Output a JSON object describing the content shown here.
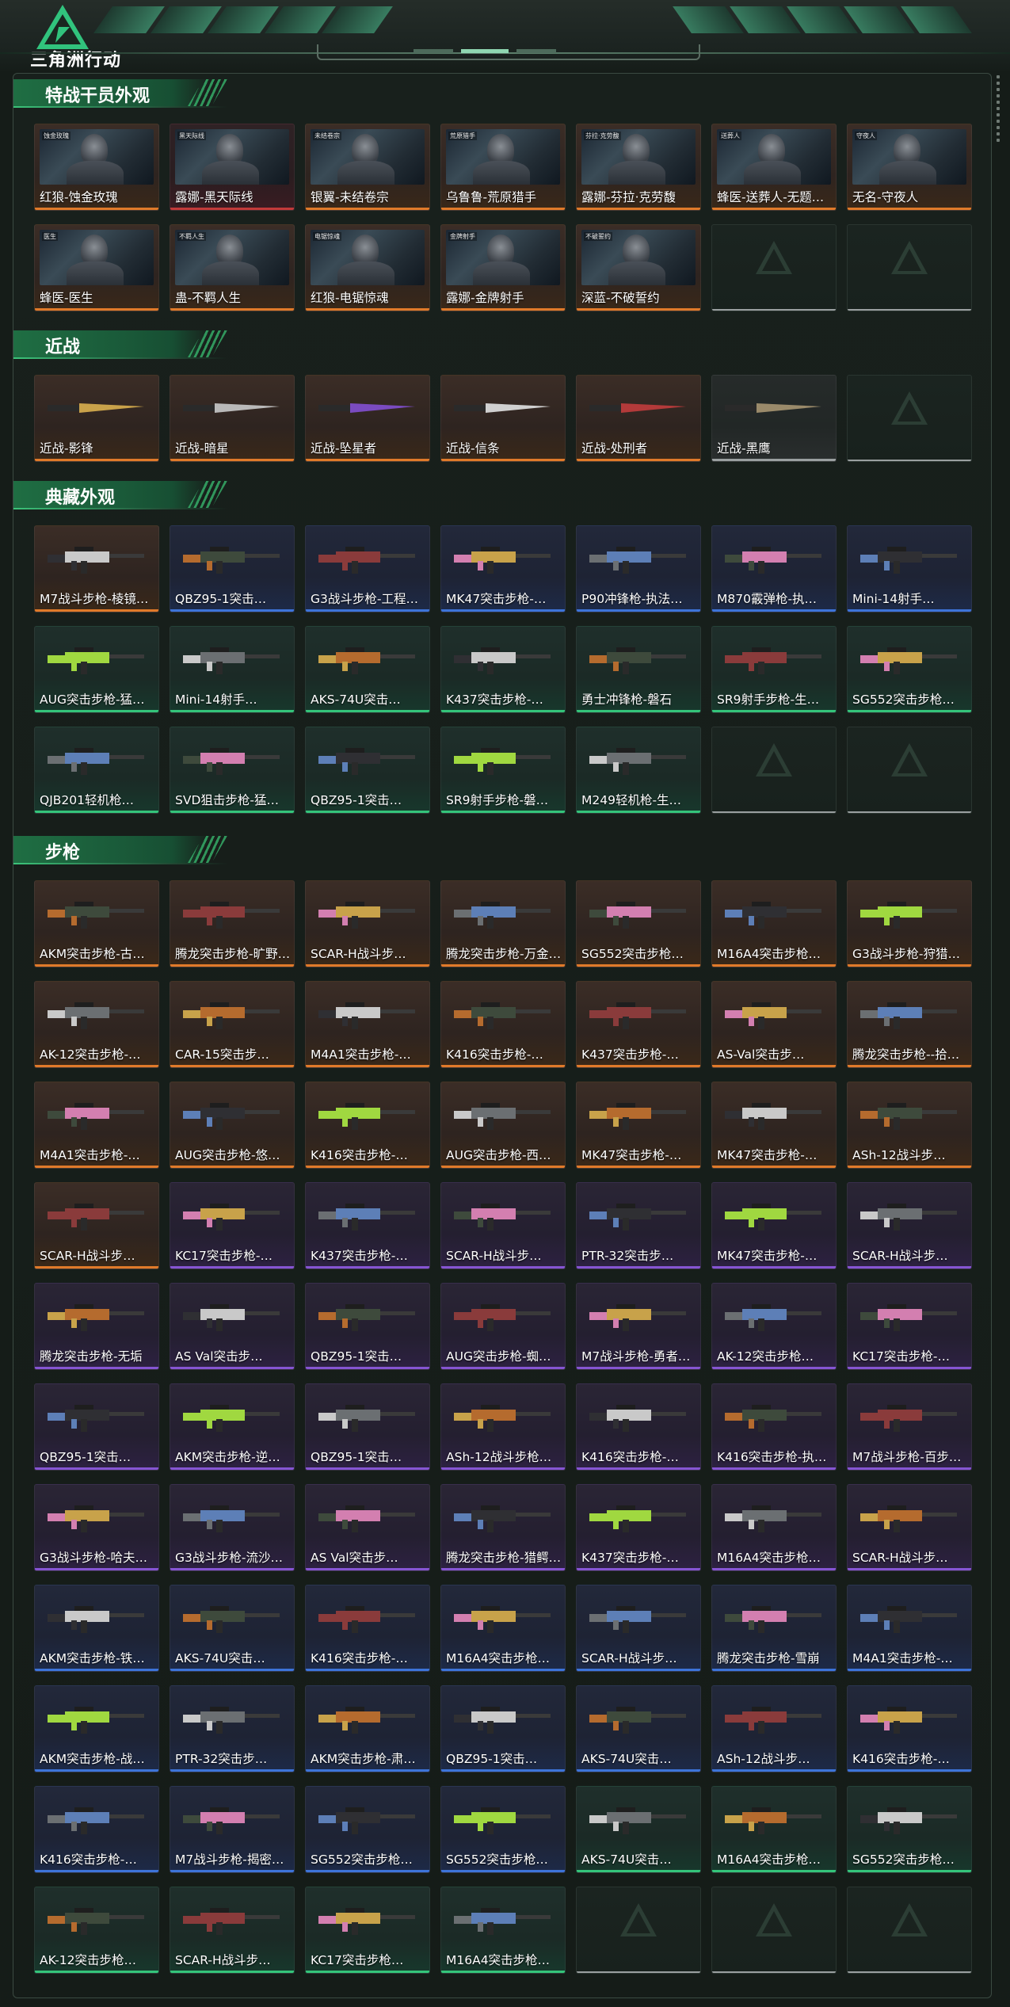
{
  "header": {
    "logo_text": "三角洲行动",
    "logo_icon": "delta-triangle-logo-icon"
  },
  "colors": {
    "background": "#151c18",
    "section_green": "#1f6e43",
    "quality_orange": "#e07a2a",
    "quality_blue": "#3d74d9",
    "quality_green": "#34c47a",
    "quality_purple": "#8655d3",
    "quality_red": "#c23a3a",
    "quality_gray": "#9a9fa0"
  },
  "sections": [
    {
      "title": "特战干员外观",
      "kind": "portrait",
      "items": [
        {
          "label": "红狼-蚀金玫瑰",
          "q": "orange",
          "tag": "蚀金玫瑰"
        },
        {
          "label": "露娜-黑天际线",
          "q": "red",
          "tag": "黑天际线"
        },
        {
          "label": "银翼-未结卷宗",
          "q": "orange",
          "tag": "未结卷宗"
        },
        {
          "label": "乌鲁鲁-荒原猎手",
          "q": "orange",
          "tag": "荒原猎手"
        },
        {
          "label": "露娜-芬拉·克劳馥",
          "q": "orange",
          "tag": "芬拉·克劳馥"
        },
        {
          "label": "蜂医-送葬人-无题…",
          "q": "orange",
          "tag": "送葬人"
        },
        {
          "label": "无名-守夜人",
          "q": "orange",
          "tag": "守夜人"
        },
        {
          "label": "蜂医-医生",
          "q": "orange",
          "tag": "医生"
        },
        {
          "label": "蛊-不羁人生",
          "q": "orange",
          "tag": "不羁人生"
        },
        {
          "label": "红狼-电锯惊魂",
          "q": "orange",
          "tag": "电锯惊魂"
        },
        {
          "label": "露娜-金牌射手",
          "q": "orange",
          "tag": "金牌射手"
        },
        {
          "label": "深蓝-不破誓约",
          "q": "orange",
          "tag": "不破誓约"
        },
        {
          "label": "",
          "q": "empty"
        },
        {
          "label": "",
          "q": "empty"
        }
      ]
    },
    {
      "title": "近战",
      "kind": "knife",
      "items": [
        {
          "label": "近战-影锋",
          "q": "orange"
        },
        {
          "label": "近战-暗星",
          "q": "orange"
        },
        {
          "label": "近战-坠星者",
          "q": "orange"
        },
        {
          "label": "近战-信条",
          "q": "orange"
        },
        {
          "label": "近战-处刑者",
          "q": "orange"
        },
        {
          "label": "近战-黑鹰",
          "q": "gray"
        },
        {
          "label": "",
          "q": "empty"
        }
      ]
    },
    {
      "title": "典藏外观",
      "kind": "gun",
      "items": [
        {
          "label": "M7战斗步枪-棱镜…",
          "q": "orange"
        },
        {
          "label": "QBZ95-1突击…",
          "q": "blue"
        },
        {
          "label": "G3战斗步枪-工程…",
          "q": "blue"
        },
        {
          "label": "MK47突击步枪-…",
          "q": "blue"
        },
        {
          "label": "P90冲锋枪-执法…",
          "q": "blue"
        },
        {
          "label": "M870霰弹枪-执…",
          "q": "blue"
        },
        {
          "label": "Mini-14射手…",
          "q": "blue"
        },
        {
          "label": "AUG突击步枪-猛…",
          "q": "green"
        },
        {
          "label": "Mini-14射手…",
          "q": "green"
        },
        {
          "label": "AKS-74U突击…",
          "q": "green"
        },
        {
          "label": "K437突击步枪-…",
          "q": "green"
        },
        {
          "label": "勇士冲锋枪-磐石",
          "q": "green"
        },
        {
          "label": "SR9射手步枪-生…",
          "q": "green"
        },
        {
          "label": "SG552突击步枪…",
          "q": "green"
        },
        {
          "label": "QJB201轻机枪…",
          "q": "green"
        },
        {
          "label": "SVD狙击步枪-猛…",
          "q": "green"
        },
        {
          "label": "QBZ95-1突击…",
          "q": "green"
        },
        {
          "label": "SR9射手步枪-磐…",
          "q": "green"
        },
        {
          "label": "M249轻机枪-生…",
          "q": "green"
        },
        {
          "label": "",
          "q": "empty"
        },
        {
          "label": "",
          "q": "empty"
        }
      ]
    },
    {
      "title": "步枪",
      "kind": "gun",
      "items": [
        {
          "label": "AKM突击步枪-古…",
          "q": "orange"
        },
        {
          "label": "腾龙突击步枪-旷野…",
          "q": "orange"
        },
        {
          "label": "SCAR-H战斗步…",
          "q": "orange"
        },
        {
          "label": "腾龙突击步枪-万金…",
          "q": "orange"
        },
        {
          "label": "SG552突击步枪…",
          "q": "orange"
        },
        {
          "label": "M16A4突击步枪…",
          "q": "orange"
        },
        {
          "label": "G3战斗步枪-狩猎…",
          "q": "orange"
        },
        {
          "label": "AK-12突击步枪-…",
          "q": "orange"
        },
        {
          "label": "CAR-15突击步…",
          "q": "orange"
        },
        {
          "label": "M4A1突击步枪-…",
          "q": "orange"
        },
        {
          "label": "K416突击步枪-…",
          "q": "orange"
        },
        {
          "label": "K437突击步枪-…",
          "q": "orange"
        },
        {
          "label": "AS-Val突击步…",
          "q": "orange"
        },
        {
          "label": "腾龙突击步枪--拾…",
          "q": "orange"
        },
        {
          "label": "M4A1突击步枪-…",
          "q": "orange"
        },
        {
          "label": "AUG突击步枪-悠…",
          "q": "orange"
        },
        {
          "label": "K416突击步枪-…",
          "q": "orange"
        },
        {
          "label": "AUG突击步枪-西…",
          "q": "orange"
        },
        {
          "label": "MK47突击步枪-…",
          "q": "orange"
        },
        {
          "label": "MK47突击步枪-…",
          "q": "orange"
        },
        {
          "label": "ASh-12战斗步…",
          "q": "orange"
        },
        {
          "label": "SCAR-H战斗步…",
          "q": "orange"
        },
        {
          "label": "KC17突击步枪-…",
          "q": "purple"
        },
        {
          "label": "K437突击步枪-…",
          "q": "purple"
        },
        {
          "label": "SCAR-H战斗步…",
          "q": "purple"
        },
        {
          "label": "PTR-32突击步…",
          "q": "purple"
        },
        {
          "label": "MK47突击步枪-…",
          "q": "purple"
        },
        {
          "label": "SCAR-H战斗步…",
          "q": "purple"
        },
        {
          "label": "腾龙突击步枪-无垢",
          "q": "purple"
        },
        {
          "label": "AS Val突击步…",
          "q": "purple"
        },
        {
          "label": "QBZ95-1突击…",
          "q": "purple"
        },
        {
          "label": "AUG突击步枪-蜘…",
          "q": "purple"
        },
        {
          "label": "M7战斗步枪-勇者…",
          "q": "purple"
        },
        {
          "label": "AK-12突击步枪…",
          "q": "purple"
        },
        {
          "label": "KC17突击步枪-…",
          "q": "purple"
        },
        {
          "label": "QBZ95-1突击…",
          "q": "purple"
        },
        {
          "label": "AKM突击步枪-逆…",
          "q": "purple"
        },
        {
          "label": "QBZ95-1突击…",
          "q": "purple"
        },
        {
          "label": "ASh-12战斗步枪…",
          "q": "purple"
        },
        {
          "label": "K416突击步枪-…",
          "q": "purple"
        },
        {
          "label": "K416突击步枪-执…",
          "q": "purple"
        },
        {
          "label": "M7战斗步枪-百步…",
          "q": "purple"
        },
        {
          "label": "G3战斗步枪-哈夫…",
          "q": "purple"
        },
        {
          "label": "G3战斗步枪-流沙…",
          "q": "purple"
        },
        {
          "label": "AS Val突击步…",
          "q": "purple"
        },
        {
          "label": "腾龙突击步枪-猎鳄…",
          "q": "purple"
        },
        {
          "label": "K437突击步枪-…",
          "q": "purple"
        },
        {
          "label": "M16A4突击步枪…",
          "q": "purple"
        },
        {
          "label": "SCAR-H战斗步…",
          "q": "purple"
        },
        {
          "label": "AKM突击步枪-铁…",
          "q": "blue"
        },
        {
          "label": "AKS-74U突击…",
          "q": "blue"
        },
        {
          "label": "K416突击步枪-…",
          "q": "blue"
        },
        {
          "label": "M16A4突击步枪…",
          "q": "blue"
        },
        {
          "label": "SCAR-H战斗步…",
          "q": "blue"
        },
        {
          "label": "腾龙突击步枪-雪崩",
          "q": "blue"
        },
        {
          "label": "M4A1突击步枪-…",
          "q": "blue"
        },
        {
          "label": "AKM突击步枪-战…",
          "q": "blue"
        },
        {
          "label": "PTR-32突击步…",
          "q": "blue"
        },
        {
          "label": "AKM突击步枪-肃…",
          "q": "blue"
        },
        {
          "label": "QBZ95-1突击…",
          "q": "blue"
        },
        {
          "label": "AKS-74U突击…",
          "q": "blue"
        },
        {
          "label": "ASh-12战斗步…",
          "q": "blue"
        },
        {
          "label": "K416突击步枪-…",
          "q": "blue"
        },
        {
          "label": "K416突击步枪-…",
          "q": "blue"
        },
        {
          "label": "M7战斗步枪-揭密…",
          "q": "blue"
        },
        {
          "label": "SG552突击步枪…",
          "q": "blue"
        },
        {
          "label": "SG552突击步枪…",
          "q": "blue"
        },
        {
          "label": "AKS-74U突击…",
          "q": "green"
        },
        {
          "label": "M16A4突击步枪…",
          "q": "green"
        },
        {
          "label": "SG552突击步枪…",
          "q": "green"
        },
        {
          "label": "AK-12突击步枪…",
          "q": "green"
        },
        {
          "label": "SCAR-H战斗步…",
          "q": "green"
        },
        {
          "label": "KC17突击步枪…",
          "q": "green"
        },
        {
          "label": "M16A4突击步枪…",
          "q": "green"
        },
        {
          "label": "",
          "q": "empty"
        },
        {
          "label": "",
          "q": "empty"
        },
        {
          "label": "",
          "q": "empty"
        }
      ]
    }
  ]
}
